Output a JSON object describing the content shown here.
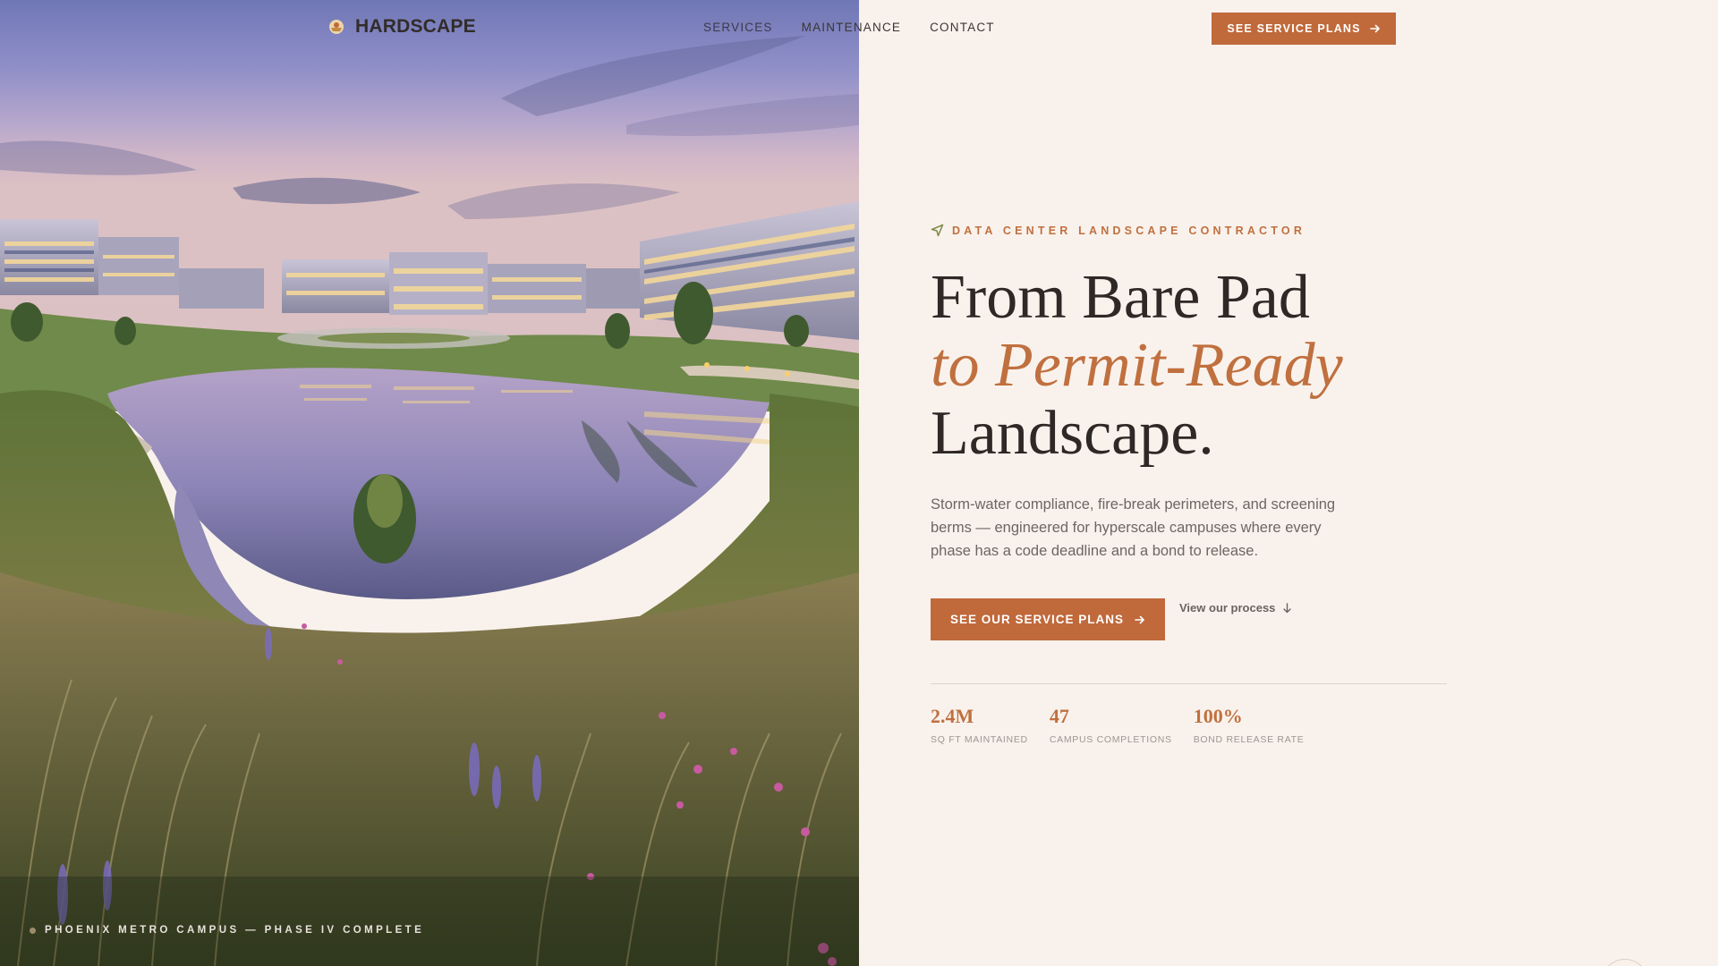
{
  "header": {
    "brand": "HARDSCAPE",
    "nav": [
      "SERVICES",
      "MAINTENANCE",
      "CONTACT"
    ],
    "cta_label": "SEE SERVICE PLANS",
    "cta_icon": "arrow-right-icon",
    "logo_icon": "sun-badge-icon"
  },
  "hero": {
    "eyebrow": "DATA CENTER LANDSCAPE CONTRACTOR",
    "eyebrow_icon": "navigation-arrow-icon",
    "headline_line1": "From Bare Pad",
    "headline_accent": "to Permit-Ready",
    "headline_line3": "Landscape.",
    "lede": "Storm-water compliance, fire-break perimeters, and screening berms — engineered for hyperscale campuses where every phase has a code deadline and a bond to release.",
    "primary_cta": "SEE OUR SERVICE PLANS",
    "secondary_cta": "View our process",
    "secondary_icon": "arrow-down-icon"
  },
  "stats": [
    {
      "value": "2.4M",
      "label": "SQ FT MAINTAINED"
    },
    {
      "value": "47",
      "label": "CAMPUS COMPLETIONS"
    },
    {
      "value": "100%",
      "label": "BOND RELEASE RATE"
    }
  ],
  "image": {
    "caption": "PHOENIX METRO CAMPUS — PHASE IV COMPLETE"
  },
  "colors": {
    "accent": "#c0693b",
    "background": "#f9f2ec",
    "text": "#2e2826"
  }
}
